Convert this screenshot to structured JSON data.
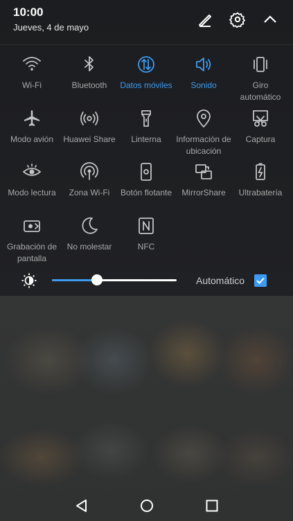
{
  "header": {
    "time": "10:00",
    "date": "Jueves, 4 de mayo",
    "icons": [
      "edit-icon",
      "settings-icon",
      "collapse-icon"
    ]
  },
  "colors": {
    "active": "#3d9bf2",
    "inactive": "#a9a9ab",
    "panel_bg": "#1c1d20"
  },
  "tiles": [
    {
      "label": "Wi-Fi",
      "icon": "wifi-icon",
      "active": false
    },
    {
      "label": "Bluetooth",
      "icon": "bluetooth-icon",
      "active": false
    },
    {
      "label": "Datos móviles",
      "icon": "mobile-data-icon",
      "active": true
    },
    {
      "label": "Sonido",
      "icon": "sound-icon",
      "active": true
    },
    {
      "label": "Giro\nautomático",
      "icon": "auto-rotate-icon",
      "active": false
    },
    {
      "label": "Modo avión",
      "icon": "airplane-icon",
      "active": false
    },
    {
      "label": "Huawei Share",
      "icon": "huawei-share-icon",
      "active": false
    },
    {
      "label": "Linterna",
      "icon": "flashlight-icon",
      "active": false
    },
    {
      "label": "Información de\nubicación",
      "icon": "location-icon",
      "active": false
    },
    {
      "label": "Captura",
      "icon": "screenshot-icon",
      "active": false
    },
    {
      "label": "Modo lectura",
      "icon": "eye-icon",
      "active": false
    },
    {
      "label": "Zona Wi-Fi",
      "icon": "hotspot-icon",
      "active": false
    },
    {
      "label": "Botón flotante",
      "icon": "floating-button-icon",
      "active": false
    },
    {
      "label": "MirrorShare",
      "icon": "mirrorshare-icon",
      "active": false
    },
    {
      "label": "Ultrabatería",
      "icon": "battery-icon",
      "active": false
    },
    {
      "label": "Grabación de\npantalla",
      "icon": "screen-record-icon",
      "active": false
    },
    {
      "label": "No molestar",
      "icon": "moon-icon",
      "active": false
    },
    {
      "label": "NFC",
      "icon": "nfc-icon",
      "active": false
    }
  ],
  "brightness": {
    "level": 0.36,
    "auto_label": "Automático",
    "auto_checked": true
  },
  "navigation": {
    "buttons": [
      "back-icon",
      "home-icon",
      "recents-icon"
    ]
  }
}
